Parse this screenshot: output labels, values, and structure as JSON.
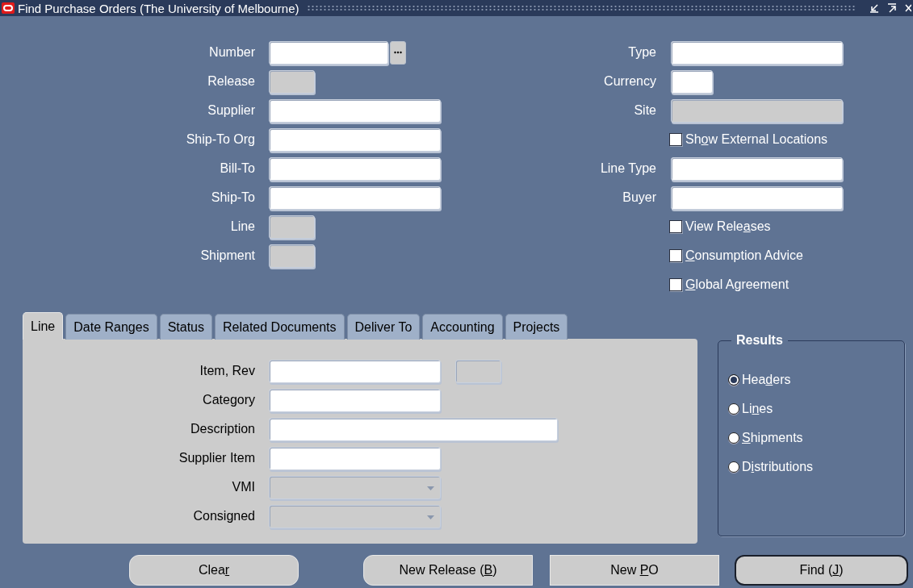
{
  "window": {
    "title": "Find Purchase Orders (The University of Melbourne)"
  },
  "left_fields": [
    {
      "label": "Number",
      "kind": "lov",
      "disabled": false
    },
    {
      "label": "Release",
      "kind": "small",
      "disabled": true
    },
    {
      "label": "Supplier",
      "kind": "text",
      "disabled": false
    },
    {
      "label": "Ship-To Org",
      "kind": "text",
      "disabled": false
    },
    {
      "label": "Bill-To",
      "kind": "text",
      "disabled": false
    },
    {
      "label": "Ship-To",
      "kind": "text",
      "disabled": false
    },
    {
      "label": "Line",
      "kind": "small",
      "disabled": true
    },
    {
      "label": "Shipment",
      "kind": "small",
      "disabled": true
    }
  ],
  "right_items": [
    {
      "kind": "text",
      "label": "Type",
      "disabled": false
    },
    {
      "kind": "tiny",
      "label": "Currency",
      "disabled": false
    },
    {
      "kind": "text",
      "label": "Site",
      "disabled": true
    },
    {
      "kind": "checkbox",
      "label": "Show External Locations",
      "checked": false
    },
    {
      "kind": "text",
      "label": "Line Type",
      "disabled": false
    },
    {
      "kind": "text",
      "label": "Buyer",
      "disabled": false
    },
    {
      "kind": "checkbox",
      "label": "View Releases",
      "checked": false
    },
    {
      "kind": "checkbox",
      "label": "Consumption Advice",
      "checked": false
    },
    {
      "kind": "checkbox",
      "label": "Global Agreement",
      "checked": false
    }
  ],
  "tabs": [
    {
      "label": "Line",
      "selected": true
    },
    {
      "label": "Date Ranges",
      "selected": false
    },
    {
      "label": "Status",
      "selected": false
    },
    {
      "label": "Related Documents",
      "selected": false
    },
    {
      "label": "Deliver To",
      "selected": false
    },
    {
      "label": "Accounting",
      "selected": false
    },
    {
      "label": "Projects",
      "selected": false
    }
  ],
  "tab_fields": [
    {
      "label": "Item, Rev",
      "kind": "pair",
      "disabled": false
    },
    {
      "label": "Category",
      "kind": "text",
      "disabled": false
    },
    {
      "label": "Description",
      "kind": "wide",
      "disabled": false
    },
    {
      "label": "Supplier Item",
      "kind": "text",
      "disabled": false
    },
    {
      "label": "VMI",
      "kind": "select",
      "disabled": true
    },
    {
      "label": "Consigned",
      "kind": "select",
      "disabled": true
    }
  ],
  "results": {
    "title": "Results",
    "options": [
      {
        "label": "Headers",
        "selected": true
      },
      {
        "label": "Lines",
        "selected": false
      },
      {
        "label": "Shipments",
        "selected": false
      },
      {
        "label": "Distributions",
        "selected": false
      }
    ]
  },
  "buttons": [
    {
      "label": "Clear",
      "default": false
    },
    {
      "label": "New Release (B)",
      "default": false
    },
    {
      "label": "New PO",
      "default": false
    },
    {
      "label": "Find (J)",
      "default": true
    }
  ]
}
